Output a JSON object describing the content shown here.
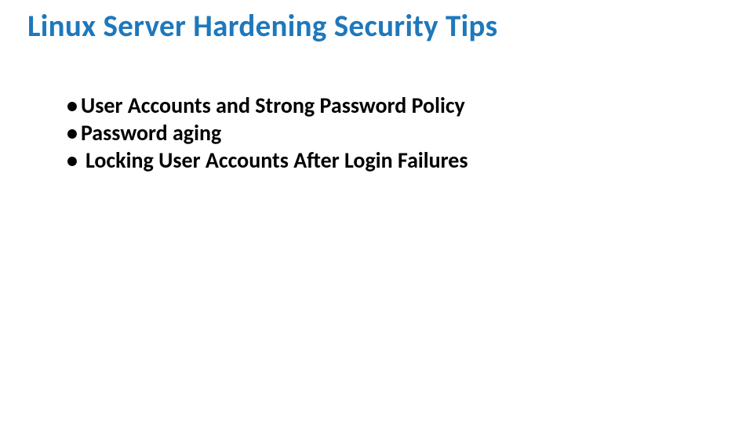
{
  "slide": {
    "title": "Linux Server Hardening Security Tips",
    "bullets": [
      "User Accounts and Strong Password Policy",
      "Password aging",
      "Locking User Accounts After Login Failures"
    ]
  }
}
